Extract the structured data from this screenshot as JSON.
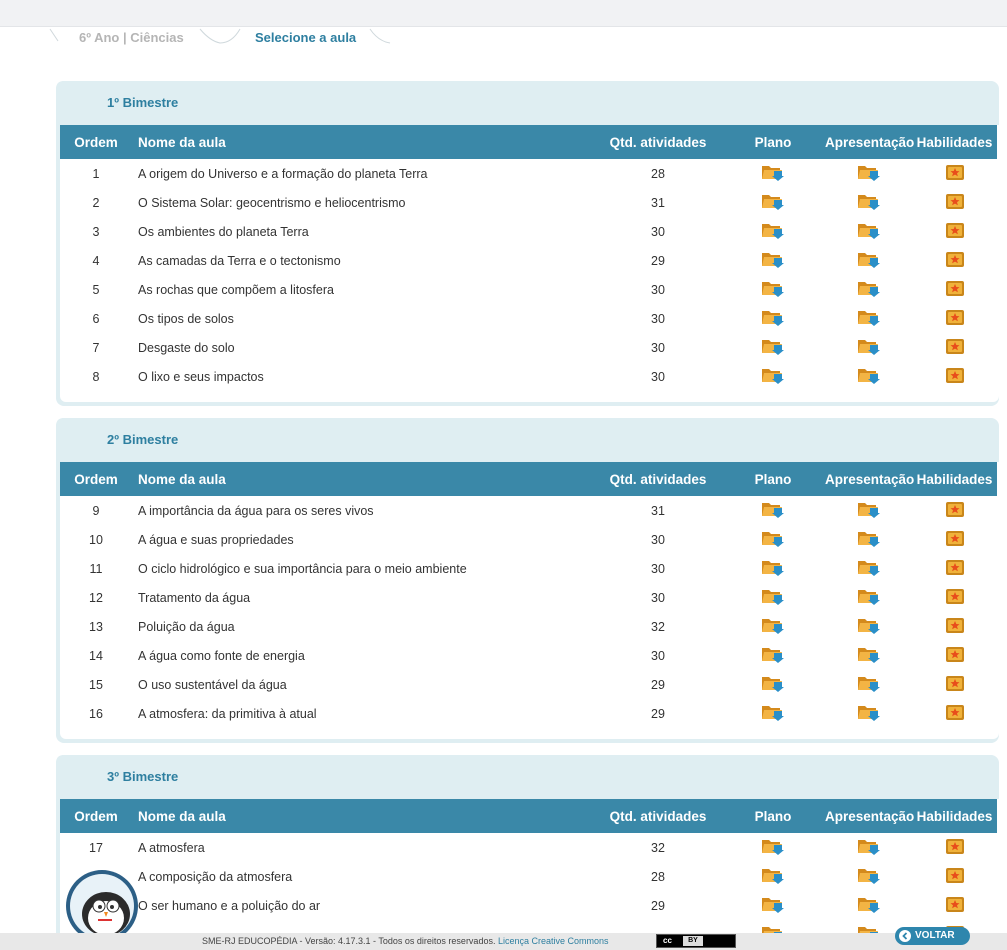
{
  "breadcrumb": {
    "items": [
      "6º Ano | Ciências",
      "Selecione a aula"
    ]
  },
  "columns": {
    "ordem": "Ordem",
    "nome": "Nome da aula",
    "qtd": "Qtd. atividades",
    "plano": "Plano",
    "apresentacao": "Apresentação",
    "habilidades": "Habilidades"
  },
  "bimestres": [
    {
      "title": "1º Bimestre",
      "rows": [
        {
          "ordem": "1",
          "nome": "A origem do Universo e a formação do planeta Terra",
          "qtd": "28"
        },
        {
          "ordem": "2",
          "nome": "O Sistema Solar: geocentrismo e heliocentrismo",
          "qtd": "31"
        },
        {
          "ordem": "3",
          "nome": "Os ambientes do planeta Terra",
          "qtd": "30"
        },
        {
          "ordem": "4",
          "nome": "As camadas da Terra e o tectonismo",
          "qtd": "29"
        },
        {
          "ordem": "5",
          "nome": "As rochas que compõem a litosfera",
          "qtd": "30"
        },
        {
          "ordem": "6",
          "nome": "Os tipos de solos",
          "qtd": "30"
        },
        {
          "ordem": "7",
          "nome": "Desgaste do solo",
          "qtd": "30"
        },
        {
          "ordem": "8",
          "nome": "O lixo e seus impactos",
          "qtd": "30"
        }
      ]
    },
    {
      "title": "2º Bimestre",
      "rows": [
        {
          "ordem": "9",
          "nome": "A importância da água para os seres vivos",
          "qtd": "31"
        },
        {
          "ordem": "10",
          "nome": "A água e suas propriedades",
          "qtd": "30"
        },
        {
          "ordem": "11",
          "nome": "O ciclo hidrológico e sua importância para o meio ambiente",
          "qtd": "30"
        },
        {
          "ordem": "12",
          "nome": "Tratamento da água",
          "qtd": "30"
        },
        {
          "ordem": "13",
          "nome": "Poluição da água",
          "qtd": "32"
        },
        {
          "ordem": "14",
          "nome": "A água como fonte de energia",
          "qtd": "30"
        },
        {
          "ordem": "15",
          "nome": "O uso sustentável da água",
          "qtd": "29"
        },
        {
          "ordem": "16",
          "nome": "A atmosfera: da primitiva à atual",
          "qtd": "29"
        }
      ]
    },
    {
      "title": "3º Bimestre",
      "rows": [
        {
          "ordem": "17",
          "nome": "A atmosfera",
          "qtd": "32"
        },
        {
          "ordem": "",
          "nome": "A composição da atmosfera",
          "qtd": "28"
        },
        {
          "ordem": "",
          "nome": "O ser humano e a poluição do ar",
          "qtd": "29"
        },
        {
          "ordem": "",
          "nome": "",
          "qtd": ""
        }
      ]
    }
  ],
  "icons": {
    "plano": "folder-download-icon",
    "apresentacao": "folder-download-icon",
    "habilidades": "star-badge-icon"
  },
  "colors": {
    "header_bg": "#3a88a8",
    "accent": "#2e7fa0",
    "panel_bg": "#dfeef2",
    "folder": "#f0a830",
    "arrow": "#2a8fc8",
    "badge": "#e69a1e"
  },
  "footer": {
    "text": "SME-RJ EDUCOPÉDIA - Versão: 4.17.3.1 - Todos os direitos reservados.",
    "license_link": "Licença Creative Commons",
    "cc_label": "cc",
    "by_label": "BY"
  },
  "voltar_label": "VOLTAR"
}
